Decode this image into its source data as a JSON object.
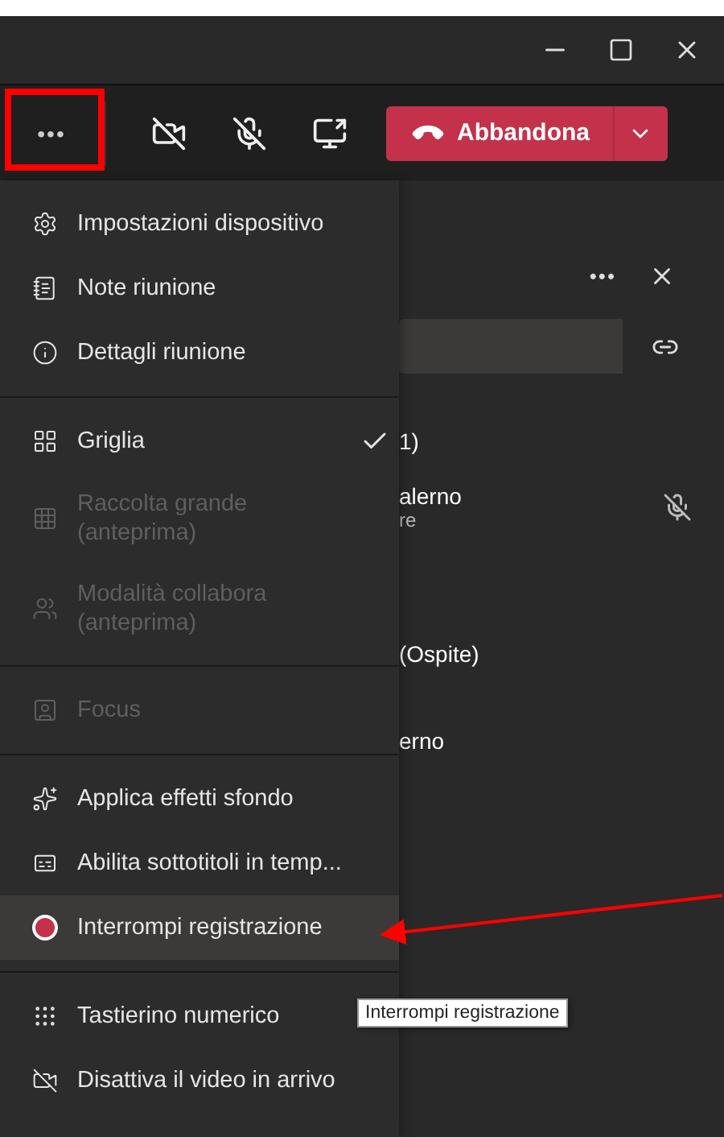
{
  "toolbar": {
    "more_label": "•••",
    "leave_button": {
      "label": "Abbandona"
    }
  },
  "side_panel": {
    "more_label": "•••",
    "texts": [
      {
        "kind": "heading",
        "text": "1)"
      },
      {
        "kind": "person",
        "name": "alerno",
        "role": "re",
        "muted": true
      },
      {
        "kind": "plain",
        "text": "(Ospite)"
      },
      {
        "kind": "plain",
        "text": "erno"
      }
    ]
  },
  "menu": {
    "groups": [
      [
        {
          "label": "Impostazioni dispositivo",
          "disabled": false,
          "checked": false,
          "selected": false
        },
        {
          "label": "Note riunione",
          "disabled": false,
          "checked": false,
          "selected": false
        },
        {
          "label": "Dettagli riunione",
          "disabled": false,
          "checked": false,
          "selected": false
        }
      ],
      [
        {
          "label": "Griglia",
          "disabled": false,
          "checked": true,
          "selected": false
        },
        {
          "label": "Raccolta grande\n(anteprima)",
          "disabled": true,
          "checked": false,
          "selected": false
        },
        {
          "label": "Modalità collabora\n(anteprima)",
          "disabled": true,
          "checked": false,
          "selected": false
        }
      ],
      [
        {
          "label": "Focus",
          "disabled": true,
          "checked": false,
          "selected": false
        }
      ],
      [
        {
          "label": "Applica effetti sfondo",
          "disabled": false,
          "checked": false,
          "selected": false
        },
        {
          "label": "Abilita sottotitoli in temp...",
          "disabled": false,
          "checked": false,
          "selected": false
        },
        {
          "label": "Interrompi registrazione",
          "disabled": false,
          "checked": false,
          "selected": true
        }
      ],
      [
        {
          "label": "Tastierino numerico",
          "disabled": false,
          "checked": false,
          "selected": false
        },
        {
          "label": "Disattiva il video in arrivo",
          "disabled": false,
          "checked": false,
          "selected": false
        }
      ]
    ]
  },
  "tooltip": {
    "text": "Interrompi registrazione"
  }
}
